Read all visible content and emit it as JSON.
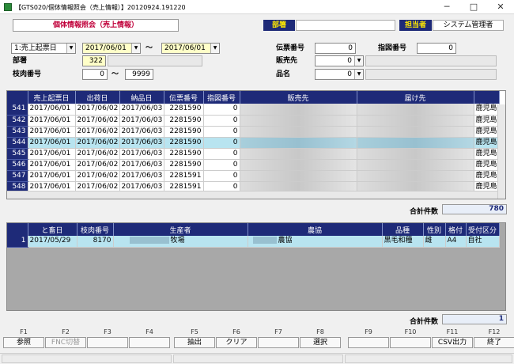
{
  "window": {
    "title": "【GTS020/個体情報照会（売上情報）】20120924.191220"
  },
  "header": {
    "screen_title": "個体情報照会（売上情報）",
    "dept_label": "部署",
    "user_label": "担当者",
    "user_value": "システム管理者"
  },
  "filters": {
    "date_type": "1:売上起票日",
    "date_from": "2017/06/01",
    "date_to": "2017/06/01",
    "tilde": "〜",
    "dept_label": "部署",
    "dept_code": "322",
    "meat_no_label": "枝肉番号",
    "meat_no_from": "0",
    "meat_no_to": "9999",
    "slip_no_label": "伝票番号",
    "slip_no": "0",
    "instruct_no_label": "指図番号",
    "instruct_no": "0",
    "customer_label": "販売先",
    "customer": "0",
    "item_label": "品名",
    "item": "0"
  },
  "sales_grid": {
    "columns": [
      "",
      "売上起票日",
      "出荷日",
      "納品日",
      "伝票番号",
      "指図番号",
      "販売先",
      "届け先",
      ""
    ],
    "rows": [
      {
        "no": "541",
        "sale_date": "2017/06/01",
        "ship_date": "2017/06/02",
        "deliv_date": "2017/06/03",
        "slip": "2281590",
        "instr": "0",
        "dest": "鹿児島"
      },
      {
        "no": "542",
        "sale_date": "2017/06/01",
        "ship_date": "2017/06/02",
        "deliv_date": "2017/06/03",
        "slip": "2281590",
        "instr": "0",
        "dest": "鹿児島"
      },
      {
        "no": "543",
        "sale_date": "2017/06/01",
        "ship_date": "2017/06/02",
        "deliv_date": "2017/06/03",
        "slip": "2281590",
        "instr": "0",
        "dest": "鹿児島"
      },
      {
        "no": "544",
        "sale_date": "2017/06/01",
        "ship_date": "2017/06/02",
        "deliv_date": "2017/06/03",
        "slip": "2281590",
        "instr": "0",
        "dest": "鹿児島"
      },
      {
        "no": "545",
        "sale_date": "2017/06/01",
        "ship_date": "2017/06/02",
        "deliv_date": "2017/06/03",
        "slip": "2281590",
        "instr": "0",
        "dest": "鹿児島"
      },
      {
        "no": "546",
        "sale_date": "2017/06/01",
        "ship_date": "2017/06/02",
        "deliv_date": "2017/06/03",
        "slip": "2281590",
        "instr": "0",
        "dest": "鹿児島"
      },
      {
        "no": "547",
        "sale_date": "2017/06/01",
        "ship_date": "2017/06/02",
        "deliv_date": "2017/06/03",
        "slip": "2281591",
        "instr": "0",
        "dest": "鹿児島"
      },
      {
        "no": "548",
        "sale_date": "2017/06/01",
        "ship_date": "2017/06/02",
        "deliv_date": "2017/06/03",
        "slip": "2281591",
        "instr": "0",
        "dest": "鹿児島"
      }
    ],
    "count_label": "合計件数",
    "count": "780"
  },
  "individual_grid": {
    "columns": [
      "",
      "と畜日",
      "枝肉番号",
      "生産者",
      "農協",
      "品種",
      "性別",
      "格付",
      "受付区分"
    ],
    "rows": [
      {
        "no": "1",
        "slaughter_date": "2017/05/29",
        "meat_no": "8170",
        "producer": "牧場",
        "coop": "農協",
        "breed": "黒毛和種",
        "sex": "雌",
        "grade": "A4",
        "recv": "自社"
      }
    ],
    "count_label": "合計件数",
    "count": "1"
  },
  "fkeys": [
    {
      "key": "F1",
      "label": "参照",
      "enabled": true
    },
    {
      "key": "F2",
      "label": "FNC切替",
      "enabled": false
    },
    {
      "key": "F3",
      "label": "",
      "enabled": false
    },
    {
      "key": "F4",
      "label": "",
      "enabled": false
    },
    {
      "key": "F5",
      "label": "抽出",
      "enabled": true
    },
    {
      "key": "F6",
      "label": "クリア",
      "enabled": true
    },
    {
      "key": "F7",
      "label": "",
      "enabled": false
    },
    {
      "key": "F8",
      "label": "選択",
      "enabled": true
    },
    {
      "key": "F9",
      "label": "",
      "enabled": false
    },
    {
      "key": "F10",
      "label": "",
      "enabled": false
    },
    {
      "key": "F11",
      "label": "CSV出力",
      "enabled": true
    },
    {
      "key": "F12",
      "label": "終了",
      "enabled": true
    }
  ]
}
